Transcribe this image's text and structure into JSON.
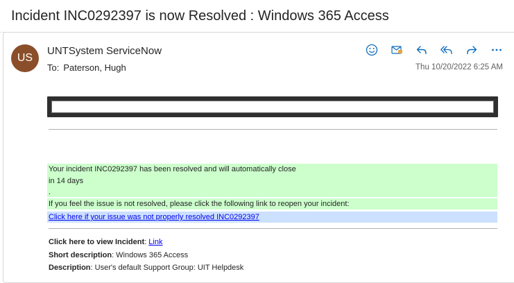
{
  "email": {
    "subject": "Incident INC0292397 is now Resolved : Windows 365 Access",
    "avatar_initials": "US",
    "sender": "UNTSystem ServiceNow",
    "to_label": "To:",
    "to_name": "Paterson, Hugh",
    "date": "Thu 10/20/2022 6:25 AM"
  },
  "actions": [
    {
      "name": "emoji-icon",
      "label": "React"
    },
    {
      "name": "envelope-icon",
      "label": "Mark"
    },
    {
      "name": "reply-icon",
      "label": "Reply"
    },
    {
      "name": "reply-all-icon",
      "label": "Reply all"
    },
    {
      "name": "forward-icon",
      "label": "Forward"
    },
    {
      "name": "more-icon",
      "label": "More"
    }
  ],
  "body": {
    "resolved_line1": "Your incident INC0292397 has been resolved and will automatically close",
    "resolved_line2": "in 14 days",
    "resolved_line3": ".",
    "reopen_text": "If you feel the issue is not resolved, please click the following link to reopen your incident:",
    "reopen_link": "Click here if your issue was not properly resolved INC0292397",
    "view_label": "Click here to view Incident",
    "view_sep": ": ",
    "view_link": "Link",
    "short_desc_label": "Short description",
    "short_desc_value": ": Windows 365 Access",
    "desc_label": "Description",
    "desc_value": ": User's default Support Group: UIT Helpdesk"
  },
  "colors": {
    "avatar_bg": "#8a4f2a",
    "accent": "#0f6cbd",
    "green_highlight": "#ccffcc",
    "blue_highlight": "#cce0ff"
  }
}
